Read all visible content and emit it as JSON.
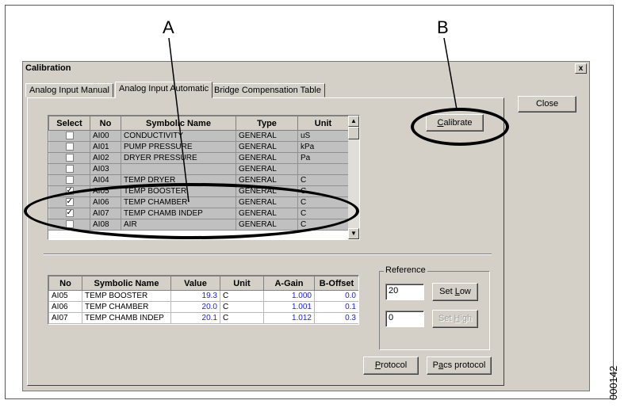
{
  "callouts": {
    "a": "A",
    "b": "B"
  },
  "figure_code": "000142",
  "window": {
    "title": "Calibration",
    "close_glyph": "x"
  },
  "tabs": [
    "Analog Input Manual",
    "Analog Input Automatic",
    "Bridge Compensation Table"
  ],
  "buttons": {
    "close": "Close",
    "calibrate": {
      "prefix": "",
      "mnemonic": "C",
      "rest": "alibrate"
    },
    "set_low": {
      "prefix": "Set ",
      "mnemonic": "L",
      "rest": "ow"
    },
    "set_high": {
      "prefix": "Set ",
      "mnemonic": "H",
      "rest": "igh"
    },
    "protocol": {
      "prefix": "",
      "mnemonic": "P",
      "rest": "rotocol"
    },
    "pacs_protocol": {
      "prefix": "P",
      "mnemonic": "a",
      "rest": "cs protocol"
    }
  },
  "channel_table": {
    "headers": [
      "Select",
      "No",
      "Symbolic Name",
      "Type",
      "Unit"
    ],
    "rows": [
      {
        "checked": false,
        "no": "AI00",
        "name": "CONDUCTIVITY",
        "type": "GENERAL",
        "unit": "uS"
      },
      {
        "checked": false,
        "no": "AI01",
        "name": "PUMP PRESSURE",
        "type": "GENERAL",
        "unit": "kPa"
      },
      {
        "checked": false,
        "no": "AI02",
        "name": "DRYER PRESSURE",
        "type": "GENERAL",
        "unit": "Pa"
      },
      {
        "checked": false,
        "no": "AI03",
        "name": "",
        "type": "GENERAL",
        "unit": ""
      },
      {
        "checked": false,
        "no": "AI04",
        "name": "TEMP DRYER",
        "type": "GENERAL",
        "unit": "C"
      },
      {
        "checked": true,
        "no": "AI05",
        "name": "TEMP BOOSTER",
        "type": "GENERAL",
        "unit": "C"
      },
      {
        "checked": true,
        "no": "AI06",
        "name": "TEMP CHAMBER",
        "type": "GENERAL",
        "unit": "C"
      },
      {
        "checked": true,
        "no": "AI07",
        "name": "TEMP CHAMB INDEP",
        "type": "GENERAL",
        "unit": "C"
      },
      {
        "checked": false,
        "no": "AI08",
        "name": "AIR",
        "type": "GENERAL",
        "unit": "C"
      }
    ],
    "check_glyph": "✓"
  },
  "calib_table": {
    "headers": [
      "No",
      "Symbolic Name",
      "Value",
      "Unit",
      "A-Gain",
      "B-Offset"
    ],
    "rows": [
      {
        "no": "AI05",
        "name": "TEMP BOOSTER",
        "value": "19.3",
        "unit": "C",
        "gain": "1.000",
        "offset": "0.0"
      },
      {
        "no": "AI06",
        "name": "TEMP CHAMBER",
        "value": "20.0",
        "unit": "C",
        "gain": "1.001",
        "offset": "0.1"
      },
      {
        "no": "AI07",
        "name": "TEMP CHAMB INDEP",
        "value": "20.1",
        "unit": "C",
        "gain": "1.012",
        "offset": "0.3"
      }
    ]
  },
  "reference": {
    "label": "Reference",
    "low_value": "20",
    "high_value": "0"
  },
  "scroll_glyphs": {
    "up": "▲",
    "down": "▼"
  }
}
